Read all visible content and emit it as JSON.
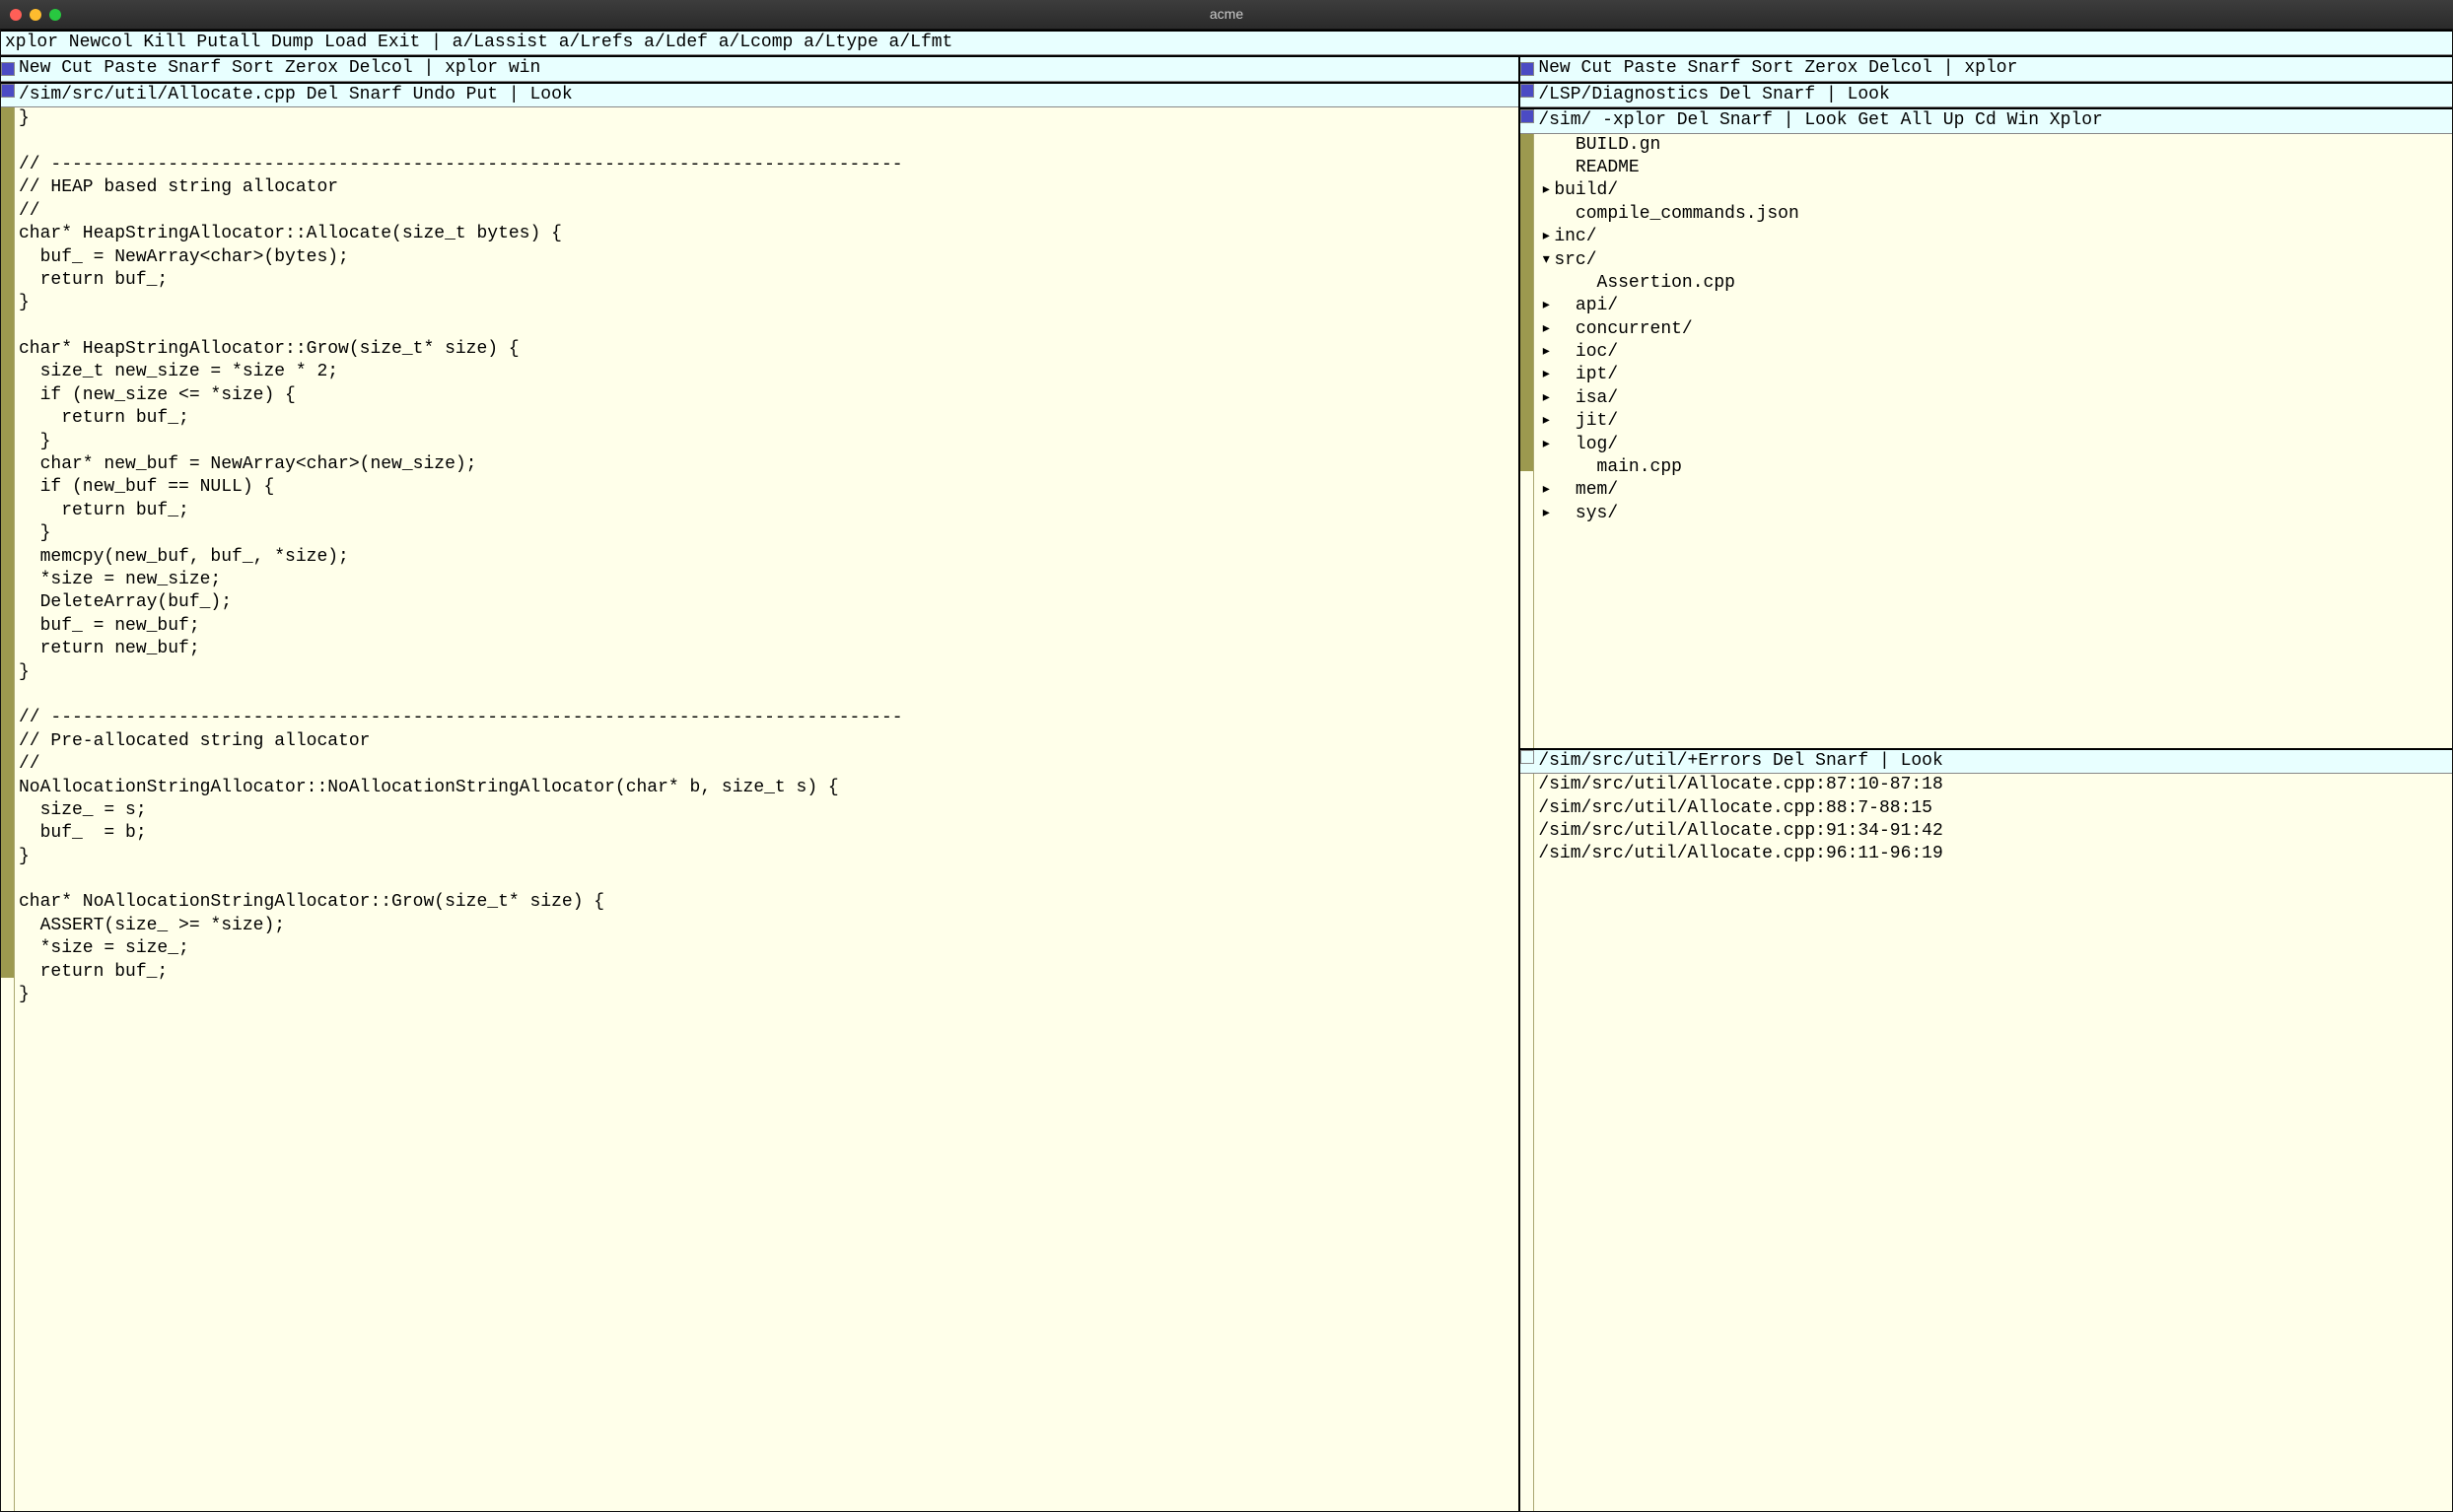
{
  "title": "acme",
  "main_tag": "xplor Newcol Kill Putall Dump  Load Exit | a/Lassist a/Lrefs a/Ldef a/Lcomp a/Ltype a/Lfmt",
  "col_left_tag": "New Cut Paste Snarf Sort Zerox Delcol | xplor win",
  "col_right_tag": "New Cut Paste Snarf Sort Zerox Delcol | xplor",
  "editor": {
    "tag": "/sim/src/util/Allocate.cpp Del Snarf Undo Put | Look",
    "code": "}\n\n// --------------------------------------------------------------------------------\n// HEAP based string allocator\n//\nchar* HeapStringAllocator::Allocate(size_t bytes) {\n  buf_ = NewArray<char>(bytes);\n  return buf_;\n}\n\nchar* HeapStringAllocator::Grow(size_t* size) {\n  size_t new_size = *size * 2;\n  if (new_size <= *size) {\n    return buf_;\n  }\n  char* new_buf = NewArray<char>(new_size);\n  if (new_buf == NULL) {\n    return buf_;\n  }\n  memcpy(new_buf, buf_, *size);\n  *size = new_size;\n  DeleteArray(buf_);\n  buf_ = new_buf;\n  return new_buf;\n}\n\n// --------------------------------------------------------------------------------\n// Pre-allocated string allocator\n//\nNoAllocationStringAllocator::NoAllocationStringAllocator(char* b, size_t s) {\n  size_ = s;\n  buf_  = b;\n}\n\nchar* NoAllocationStringAllocator::Grow(size_t* size) {\n  ASSERT(size_ >= *size);\n  *size = size_;\n  return buf_;\n}"
  },
  "diag": {
    "tag": "/LSP/Diagnostics Del Snarf | Look"
  },
  "xplor": {
    "tag": "/sim/ -xplor Del Snarf | Look Get All Up Cd Win Xplor",
    "items": [
      {
        "arrow": "",
        "indent": "  ",
        "name": "BUILD.gn"
      },
      {
        "arrow": "",
        "indent": "  ",
        "name": "README"
      },
      {
        "arrow": "▸",
        "indent": "",
        "name": "build/"
      },
      {
        "arrow": "",
        "indent": "  ",
        "name": "compile_commands.json"
      },
      {
        "arrow": "▸",
        "indent": "",
        "name": "inc/"
      },
      {
        "arrow": "▾",
        "indent": "",
        "name": "src/"
      },
      {
        "arrow": "",
        "indent": "    ",
        "name": "Assertion.cpp"
      },
      {
        "arrow": "▸",
        "indent": "  ",
        "name": "api/"
      },
      {
        "arrow": "▸",
        "indent": "  ",
        "name": "concurrent/"
      },
      {
        "arrow": "▸",
        "indent": "  ",
        "name": "ioc/"
      },
      {
        "arrow": "▸",
        "indent": "  ",
        "name": "ipt/"
      },
      {
        "arrow": "▸",
        "indent": "  ",
        "name": "isa/"
      },
      {
        "arrow": "▸",
        "indent": "  ",
        "name": "jit/"
      },
      {
        "arrow": "▸",
        "indent": "  ",
        "name": "log/"
      },
      {
        "arrow": "",
        "indent": "    ",
        "name": "main.cpp"
      },
      {
        "arrow": "▸",
        "indent": "  ",
        "name": "mem/"
      },
      {
        "arrow": "▸",
        "indent": "  ",
        "name": "sys/"
      }
    ]
  },
  "errors": {
    "tag": "/sim/src/util/+Errors Del Snarf | Look",
    "lines": [
      "/sim/src/util/Allocate.cpp:87:10-87:18",
      "/sim/src/util/Allocate.cpp:88:7-88:15",
      "/sim/src/util/Allocate.cpp:91:34-91:42",
      "/sim/src/util/Allocate.cpp:96:11-96:19"
    ]
  }
}
